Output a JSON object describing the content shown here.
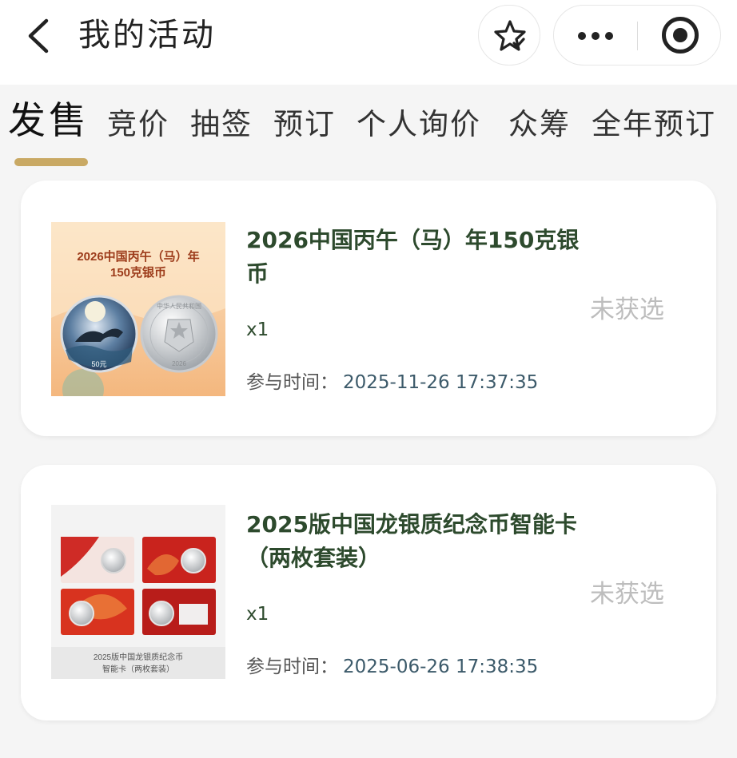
{
  "header": {
    "back_icon": "chevron-left-icon",
    "title": "我的活动",
    "star_icon": "star-check-icon",
    "more_icon": "more-dots-icon",
    "close_icon": "target-circle-icon"
  },
  "tabs": [
    {
      "label": "发售",
      "active": true
    },
    {
      "label": "竞价",
      "active": false
    },
    {
      "label": "抽签",
      "active": false
    },
    {
      "label": "预订",
      "active": false
    },
    {
      "label": "个人询价",
      "active": false
    },
    {
      "label": "众筹",
      "active": false
    },
    {
      "label": "全年预订",
      "active": false
    }
  ],
  "colors": {
    "accent_gold": "#c9a964",
    "name_green": "#2d4a2d",
    "status_gray": "#bdbdbd"
  },
  "records": [
    {
      "name": "2026中国丙午（马）年150克银币",
      "quantity": "x1",
      "time_label": "参与时间：",
      "time_value": "2025-11-26 17:37:35",
      "status": "未获选",
      "image": {
        "title_line1": "2026中国丙午（马）年",
        "title_line2": "150克银币",
        "coin_value": "50元",
        "reverse_text": "中华人民共和国",
        "year_text": "2026"
      }
    },
    {
      "name": "2025版中国龙银质纪念币智能卡（两枚套装）",
      "quantity": "x1",
      "time_label": "参与时间：",
      "time_value": "2025-06-26 17:38:35",
      "status": "未获选",
      "image": {
        "caption_line1": "2025版中国龙银质纪念币",
        "caption_line2": "智能卡（两枚套装）"
      }
    }
  ]
}
